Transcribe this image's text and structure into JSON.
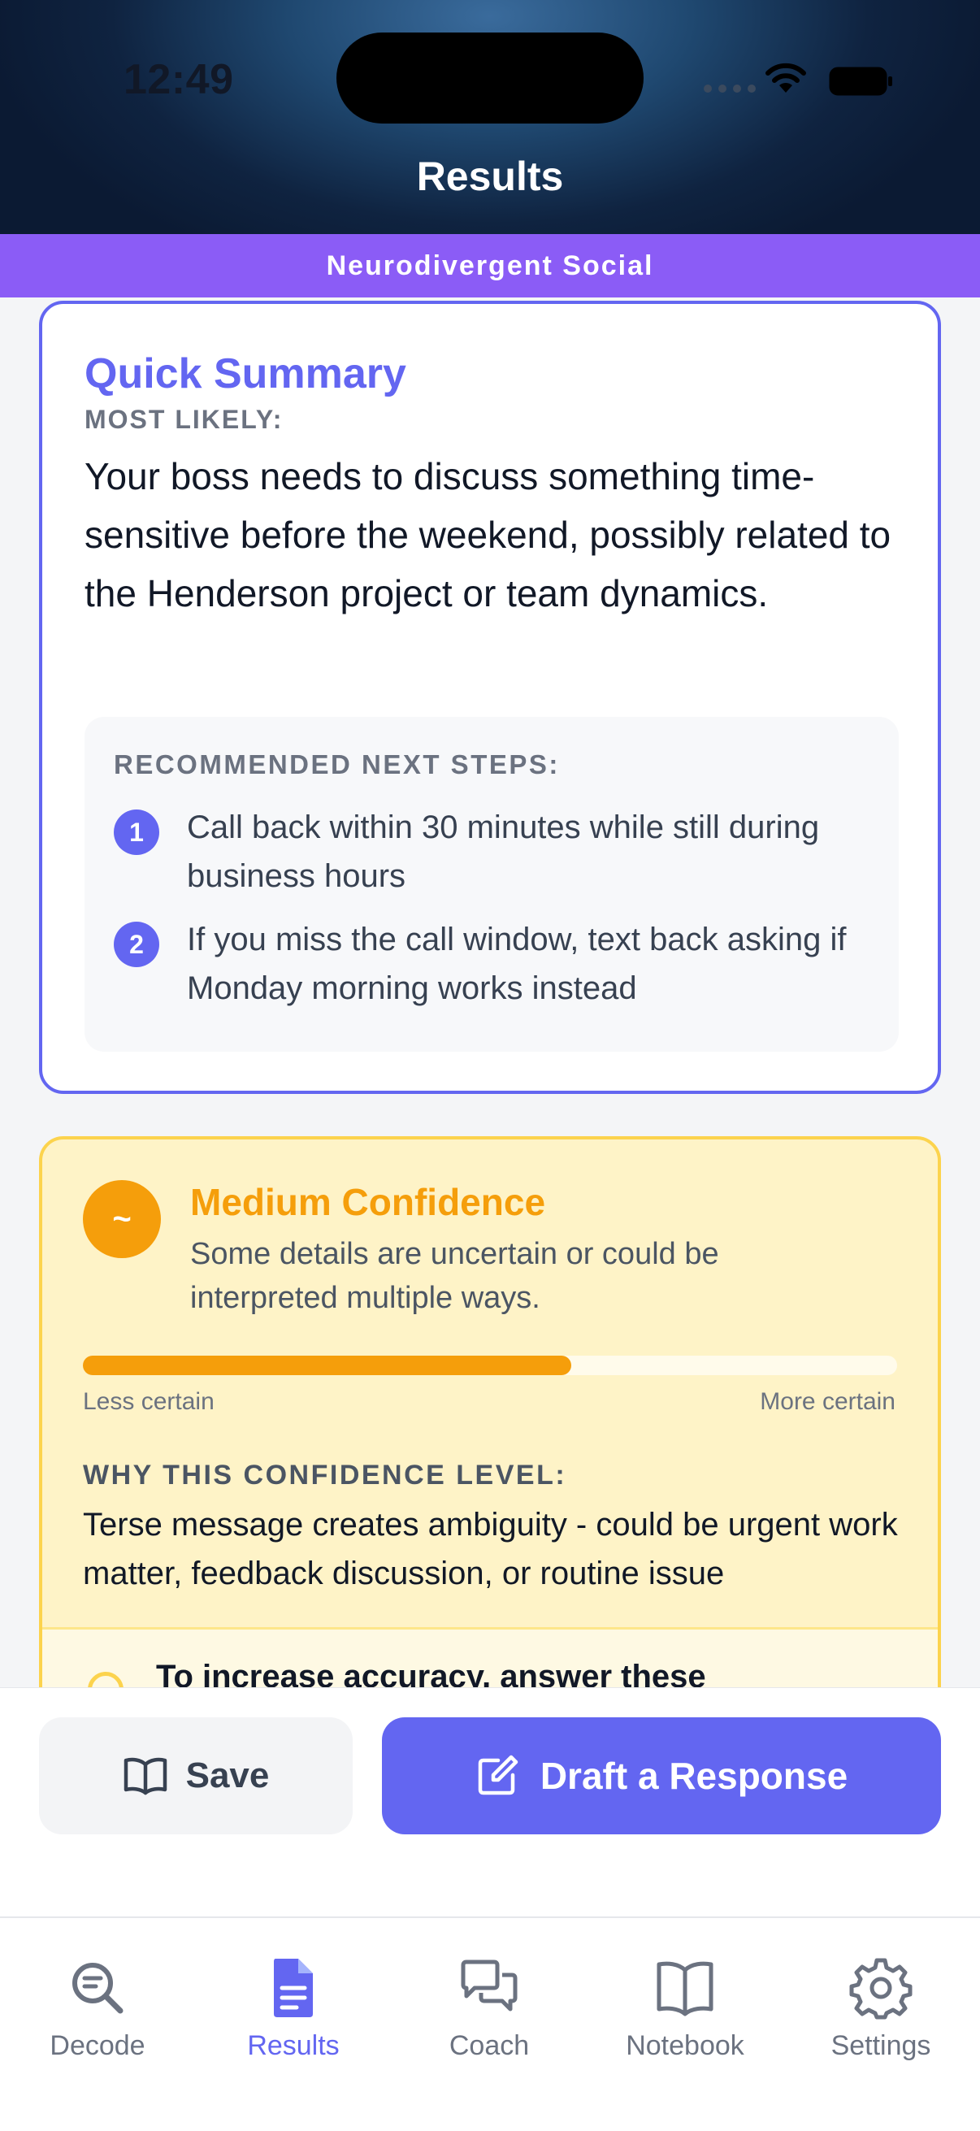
{
  "status_bar": {
    "time": "12:49"
  },
  "header": {
    "title": "Results"
  },
  "category": {
    "label": "Neurodivergent Social"
  },
  "summary": {
    "title": "Quick Summary",
    "most_likely_label": "MOST LIKELY:",
    "most_likely_text": "Your boss needs to discuss something time-sensitive before the weekend, possibly related to the Henderson project or team dynamics.",
    "steps_label": "RECOMMENDED NEXT STEPS:",
    "steps": [
      {
        "number": "1",
        "text": "Call back within 30 minutes while still during business hours"
      },
      {
        "number": "2",
        "text": "If you miss the call window, text back asking if Monday morning works instead"
      }
    ]
  },
  "confidence": {
    "badge": "~",
    "title": "Medium Confidence",
    "description": "Some details are uncertain or could be interpreted multiple ways.",
    "level": 0.6,
    "less_label": "Less certain",
    "more_label": "More certain",
    "why_label": "WHY THIS CONFIDENCE LEVEL:",
    "why_text": "Terse message creates ambiguity - could be urgent work matter, feedback discussion, or routine issue",
    "accuracy_prompt": "To increase accuracy, answer these"
  },
  "actions": {
    "save_label": "Save",
    "draft_label": "Draft a Response"
  },
  "tabs": [
    {
      "label": "Decode",
      "icon": "search-doc-icon",
      "active": false
    },
    {
      "label": "Results",
      "icon": "document-icon",
      "active": true
    },
    {
      "label": "Coach",
      "icon": "chat-bubbles-icon",
      "active": false
    },
    {
      "label": "Notebook",
      "icon": "book-icon",
      "active": false
    },
    {
      "label": "Settings",
      "icon": "gear-icon",
      "active": false
    }
  ],
  "colors": {
    "accent": "#6366f1",
    "category": "#8b5cf6",
    "confidence": "#f59e0b"
  }
}
